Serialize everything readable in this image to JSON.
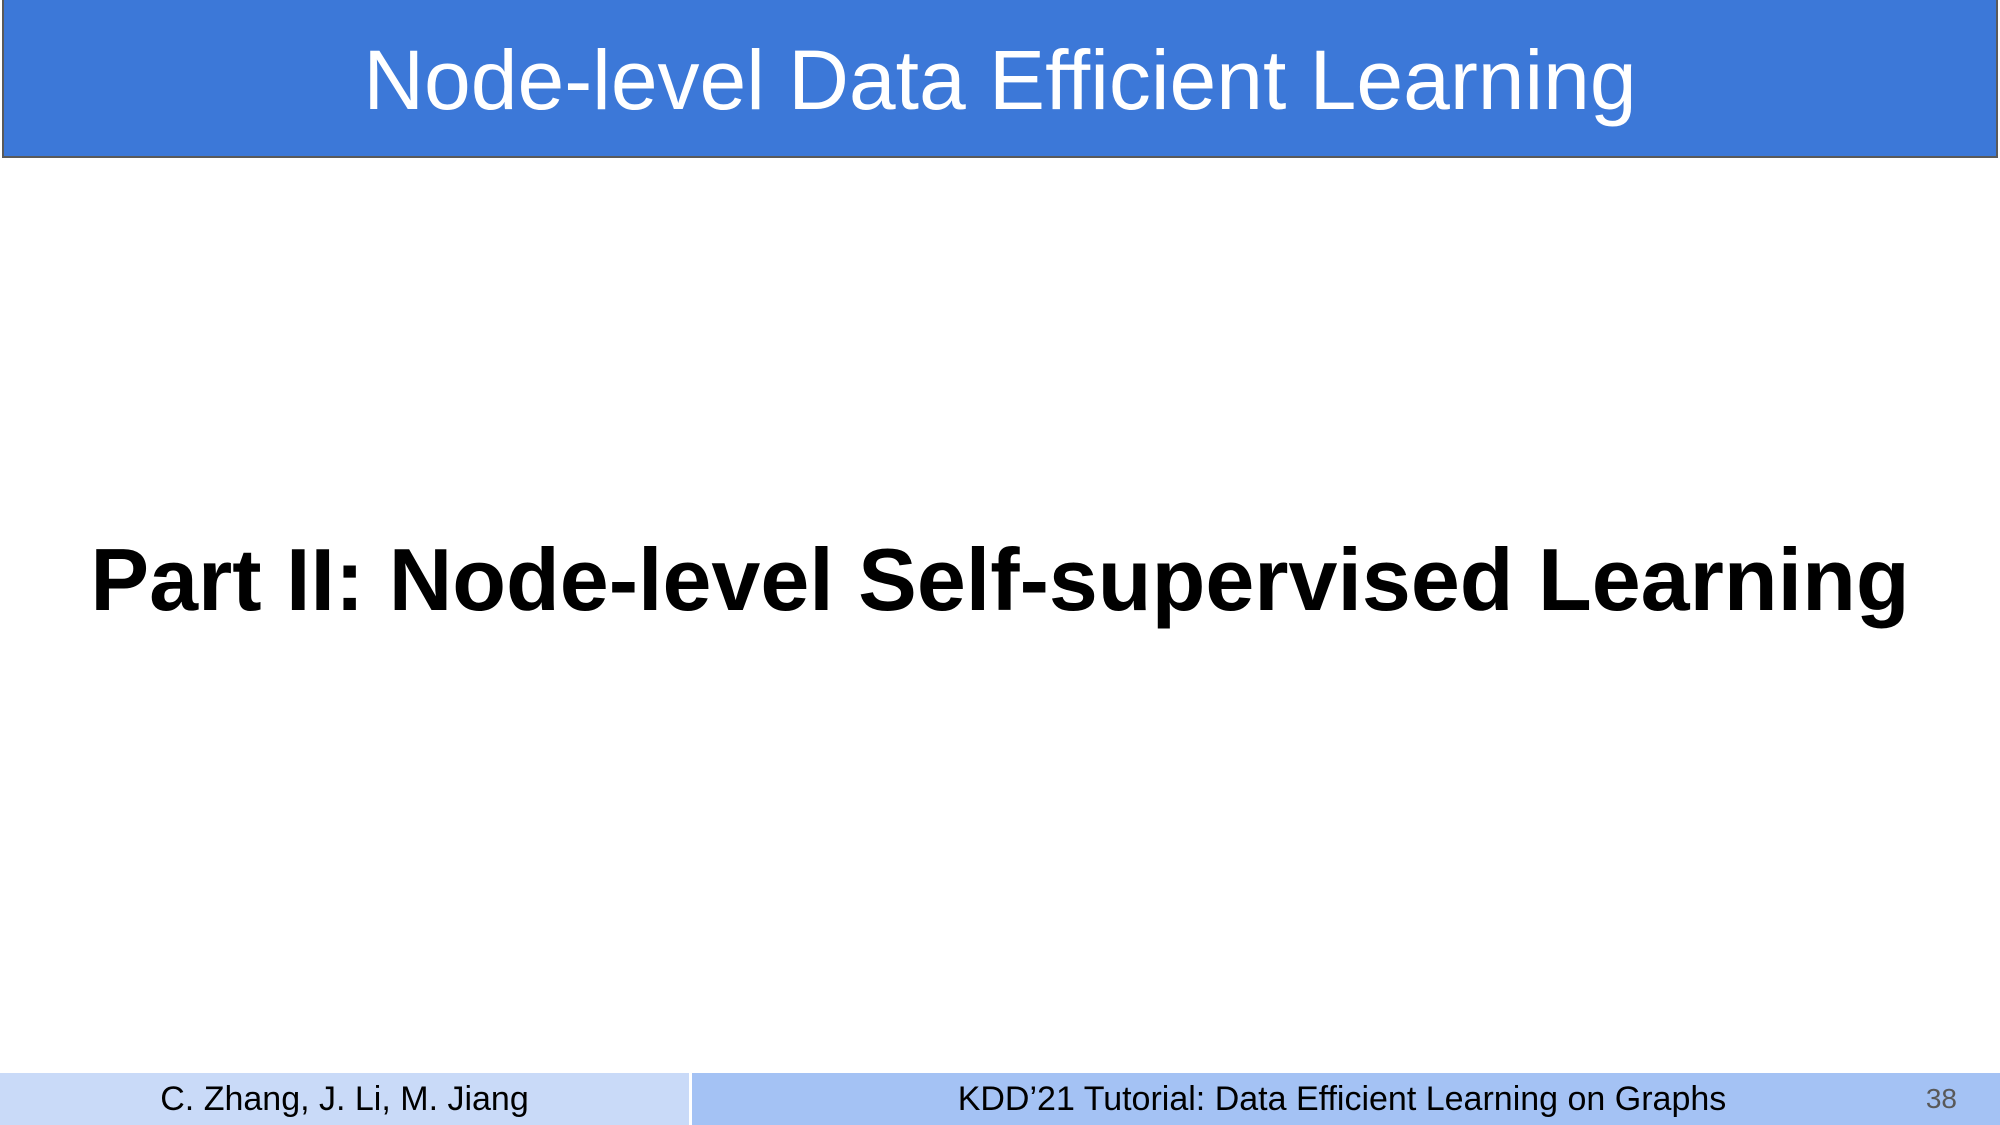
{
  "header": {
    "title": "Node-level Data Efficient Learning"
  },
  "main": {
    "heading": "Part II: Node-level Self-supervised Learning"
  },
  "footer": {
    "authors": "C. Zhang, J. Li, M. Jiang",
    "tutorial_title": "KDD’21 Tutorial: Data Efficient Learning on Graphs",
    "page_number": "38"
  },
  "colors": {
    "header_bg": "#3c78d8",
    "footer_left_bg": "#c9daf8",
    "footer_right_bg": "#a4c2f4"
  }
}
